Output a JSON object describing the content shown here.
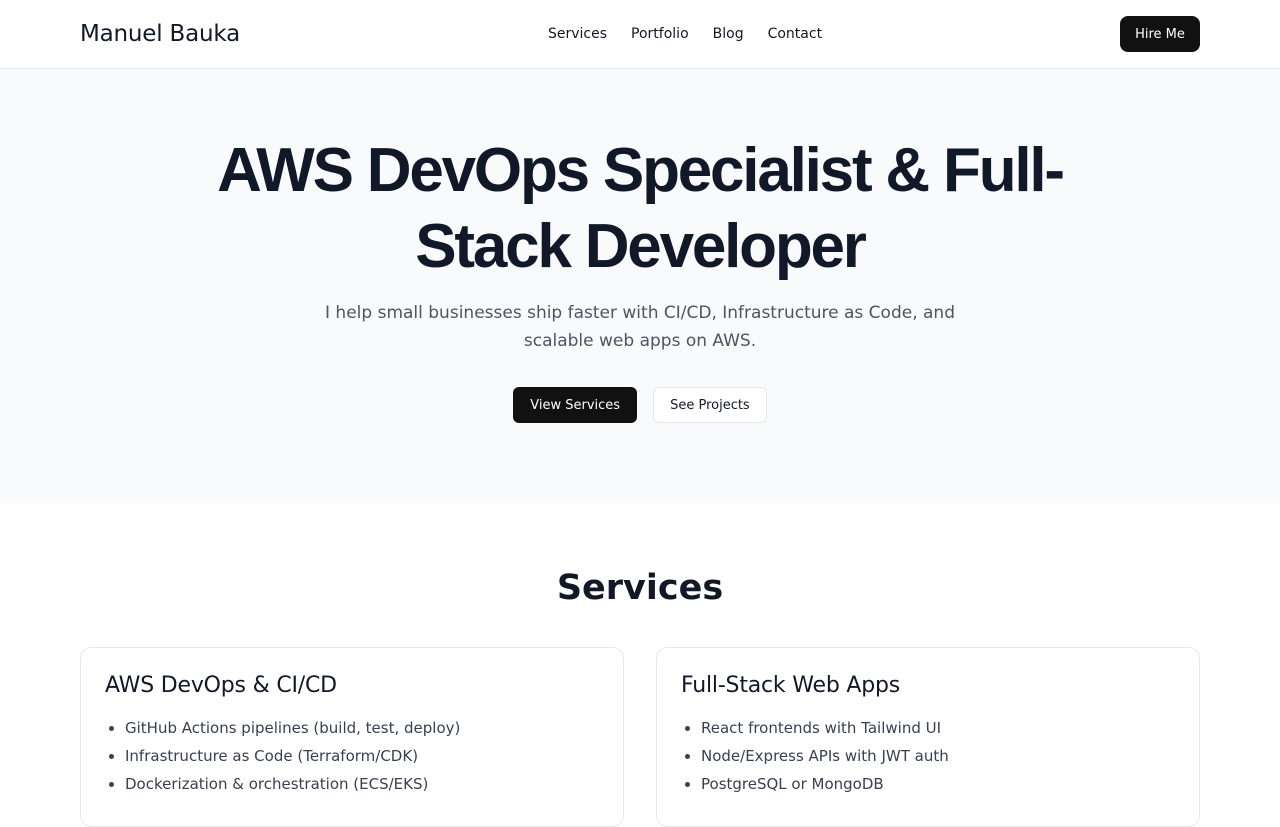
{
  "header": {
    "brand": "Manuel Bauka",
    "nav": [
      "Services",
      "Portfolio",
      "Blog",
      "Contact"
    ],
    "cta": "Hire Me"
  },
  "hero": {
    "title": "AWS DevOps Specialist & Full-Stack Developer",
    "subtitle": "I help small businesses ship faster with CI/CD, Infrastructure as Code, and scalable web apps on AWS.",
    "primary_button": "View Services",
    "secondary_button": "See Projects"
  },
  "services": {
    "title": "Services",
    "cards": [
      {
        "title": "AWS DevOps & CI/CD",
        "items": [
          "GitHub Actions pipelines (build, test, deploy)",
          "Infrastructure as Code (Terraform/CDK)",
          "Dockerization & orchestration (ECS/EKS)"
        ]
      },
      {
        "title": "Full-Stack Web Apps",
        "items": [
          "React frontends with Tailwind UI",
          "Node/Express APIs with JWT auth",
          "PostgreSQL or MongoDB"
        ]
      }
    ]
  },
  "colors": {
    "primary": "#111111",
    "text": "#111827",
    "muted": "#4b5563",
    "hero_bg": "#f9fafb",
    "border": "#e5e7eb"
  }
}
